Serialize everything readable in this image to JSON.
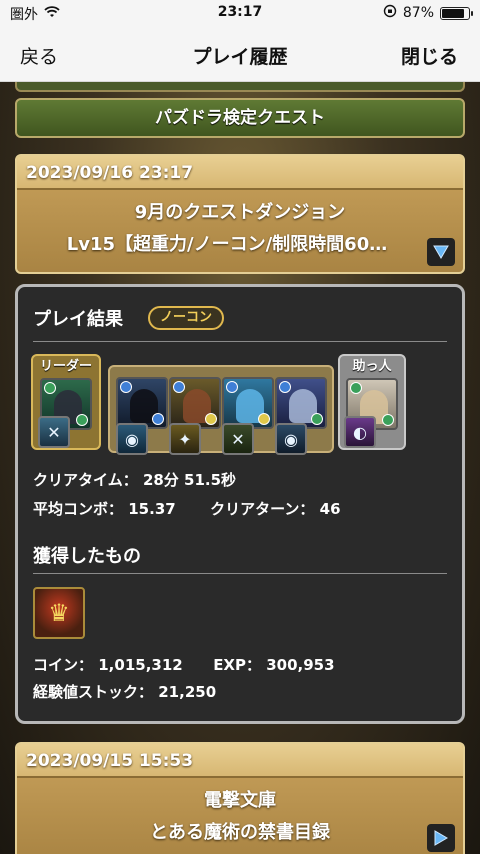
{
  "status": {
    "carrier": "圏外",
    "time": "23:17",
    "battery_percent_label": "87%",
    "battery_level": 0.87
  },
  "nav": {
    "back": "戻る",
    "title": "プレイ履歴",
    "close": "閉じる"
  },
  "quest_category": "パズドラ検定クエスト",
  "entries": [
    {
      "datetime": "2023/09/16 23:17",
      "dungeon": "9月のクエストダンジョン",
      "floor": "Lv15【超重力/ノーコン/制限時間60…"
    },
    {
      "datetime": "2023/09/15 15:53",
      "dungeon": "電撃文庫",
      "floor": "とある魔術の禁書目録"
    }
  ],
  "result": {
    "heading": "プレイ結果",
    "badge": "ノーコン",
    "leader_label": "リーダー",
    "helper_label": "助っ人",
    "clear_time_label": "クリアタイム：",
    "clear_time": "28分 51.5秒",
    "avg_combo_label": "平均コンボ：",
    "avg_combo": "15.37",
    "clear_turn_label": "クリアターン：",
    "clear_turn": "46",
    "obtained_heading": "獲得したもの",
    "coin_label": "コイン：",
    "coin": "1,015,312",
    "exp_label": "EXP：",
    "exp": "300,953",
    "stock_label": "経験値ストック：",
    "stock": "21,250"
  },
  "colors": {
    "accent_gold": "#e0b84e",
    "panel_bg": "#2a2a2a"
  }
}
